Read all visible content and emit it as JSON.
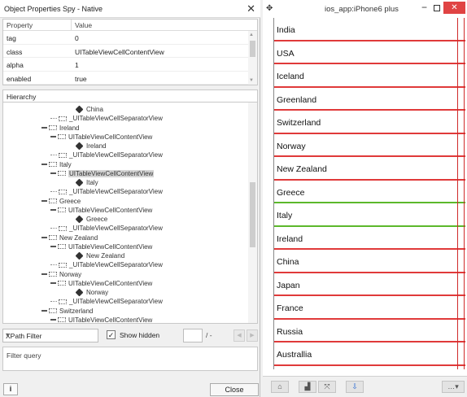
{
  "spy": {
    "title": "Object Properties Spy - Native",
    "close_glyph": "✕",
    "columns": {
      "property": "Property",
      "value": "Value"
    },
    "properties": [
      {
        "name": "tag",
        "value": "0"
      },
      {
        "name": "class",
        "value": "UITableViewCellContentView"
      },
      {
        "name": "alpha",
        "value": "1"
      },
      {
        "name": "enabled",
        "value": "true"
      }
    ],
    "hierarchy_label": "Hierarchy",
    "tree": [
      {
        "kind": "leaf",
        "text": "China"
      },
      {
        "kind": "child",
        "text": "_UITableViewCellSeparatorView"
      },
      {
        "kind": "cell",
        "text": "Ireland"
      },
      {
        "kind": "child",
        "text": "UITableViewCellContentView"
      },
      {
        "kind": "leaf",
        "text": "Ireland"
      },
      {
        "kind": "child",
        "text": "_UITableViewCellSeparatorView"
      },
      {
        "kind": "cell",
        "text": "Italy"
      },
      {
        "kind": "child",
        "text": "UITableViewCellContentView",
        "selected": true
      },
      {
        "kind": "leaf",
        "text": "Italy"
      },
      {
        "kind": "child",
        "text": "_UITableViewCellSeparatorView"
      },
      {
        "kind": "cell",
        "text": "Greece"
      },
      {
        "kind": "child",
        "text": "UITableViewCellContentView"
      },
      {
        "kind": "leaf",
        "text": "Greece"
      },
      {
        "kind": "child",
        "text": "_UITableViewCellSeparatorView"
      },
      {
        "kind": "cell",
        "text": "New Zealand"
      },
      {
        "kind": "child",
        "text": "UITableViewCellContentView"
      },
      {
        "kind": "leaf",
        "text": "New Zealand"
      },
      {
        "kind": "child",
        "text": "_UITableViewCellSeparatorView"
      },
      {
        "kind": "cell",
        "text": "Norway"
      },
      {
        "kind": "child",
        "text": "UITableViewCellContentView"
      },
      {
        "kind": "leaf",
        "text": "Norway"
      },
      {
        "kind": "child",
        "text": "_UITableViewCellSeparatorView"
      },
      {
        "kind": "cell",
        "text": "Switzerland"
      },
      {
        "kind": "child",
        "text": "UITableViewCellContentView"
      }
    ],
    "filter": {
      "xpath_label": "XPath Filter",
      "show_hidden_label": "Show hidden",
      "show_hidden_checked": true,
      "page_of": "/ -",
      "query_placeholder": "Filter query"
    },
    "info_label": "i",
    "close_label": "Close"
  },
  "app": {
    "title": "ios_app:iPhone6 plus",
    "cells": [
      "India",
      "USA",
      "Iceland",
      "Greenland",
      "Switzerland",
      "Norway",
      "New Zealand",
      "Greece",
      "Italy",
      "Ireland",
      "China",
      "Japan",
      "France",
      "Russia",
      "Australlia"
    ],
    "selected_cell": "Italy",
    "colors": {
      "separator": "#e03a3a",
      "selected": "#5cb82b",
      "close": "#e04343"
    },
    "toolbar_icons": [
      "home-icon",
      "screenshot-icon",
      "fit-icon",
      "pin-icon",
      "more-icon"
    ]
  }
}
